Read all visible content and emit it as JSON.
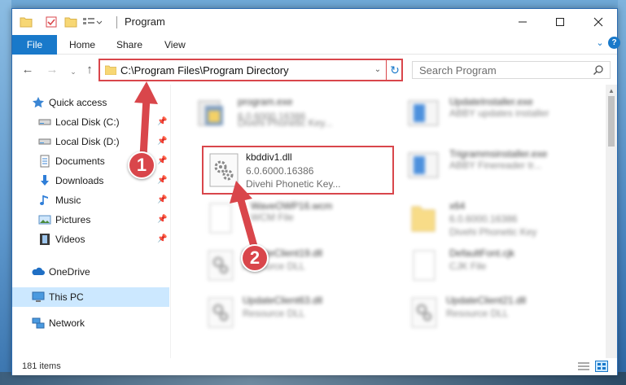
{
  "window": {
    "title": "Program"
  },
  "ribbon": {
    "file": "File",
    "home": "Home",
    "share": "Share",
    "view": "View"
  },
  "nav": {
    "address": "C:\\Program Files\\Program Directory",
    "search_placeholder": "Search Program"
  },
  "sidebar": {
    "items": [
      {
        "label": "Quick access",
        "icon": "star-icon"
      },
      {
        "label": "Local Disk (C:)",
        "icon": "drive-icon",
        "pinned": true
      },
      {
        "label": "Local Disk (D:)",
        "icon": "drive-icon",
        "pinned": true
      },
      {
        "label": "Documents",
        "icon": "documents-icon",
        "pinned": true
      },
      {
        "label": "Downloads",
        "icon": "download-icon",
        "pinned": true
      },
      {
        "label": "Music",
        "icon": "music-icon",
        "pinned": true
      },
      {
        "label": "Pictures",
        "icon": "pictures-icon",
        "pinned": true
      },
      {
        "label": "Videos",
        "icon": "videos-icon",
        "pinned": true
      },
      {
        "label": "OneDrive",
        "icon": "cloud-icon"
      },
      {
        "label": "This PC",
        "icon": "computer-icon",
        "selected": true
      },
      {
        "label": "Network",
        "icon": "network-icon"
      }
    ]
  },
  "files": [
    {
      "name": "program.exe",
      "meta": "6.0.6000.16386",
      "meta2": "Divehi Phonetic Key...",
      "blurred": true
    },
    {
      "name": "UpdateInstaller.exe",
      "meta": "ABBY updates installer",
      "meta2": "",
      "blurred": true
    },
    {
      "name": "kbddiv1.dll",
      "meta": "6.0.6000.16386",
      "meta2": "Divehi Phonetic Key...",
      "blurred": false,
      "focused": true
    },
    {
      "name": "Trigrammsinstaller.exe",
      "meta": "ABBY Finereader tr...",
      "meta2": "",
      "blurred": true
    },
    {
      "name": "WaveOWP16.wcm",
      "meta": "WCM File",
      "meta2": "",
      "blurred": true
    },
    {
      "name": "x64",
      "meta": "6.0.6000.16386",
      "meta2": "Divehi Phonetic Key",
      "blurred": true
    },
    {
      "name": "UpdateClient19.dll",
      "meta": "Resource DLL",
      "meta2": "",
      "blurred": true
    },
    {
      "name": "DefaultFont.cjk",
      "meta": "CJK File",
      "meta2": "",
      "blurred": true
    },
    {
      "name": "UpdateClient63.dll",
      "meta": "Resource DLL",
      "meta2": "",
      "blurred": true
    },
    {
      "name": "UpdateClient21.dll",
      "meta": "Resource DLL",
      "meta2": "",
      "blurred": true
    }
  ],
  "status": {
    "items_count": "181 items"
  },
  "annotations": {
    "marker1": "1",
    "marker2": "2"
  },
  "colors": {
    "accent": "#1979ca",
    "highlight": "#d9464b",
    "selected_bg": "#cce8ff"
  }
}
